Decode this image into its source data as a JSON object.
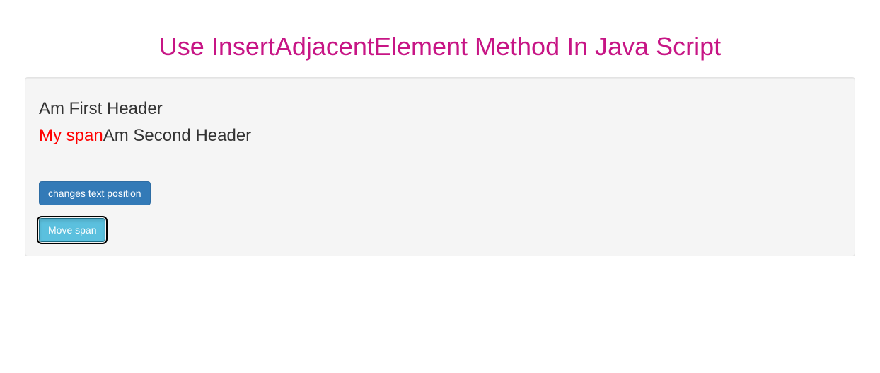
{
  "title": "Use InsertAdjacentElement Method In Java Script",
  "headers": {
    "first": "Am First Header",
    "second": "Am Second Header",
    "span_text": "My span"
  },
  "buttons": {
    "changes_position": "changes text position",
    "move_span": "Move span"
  }
}
